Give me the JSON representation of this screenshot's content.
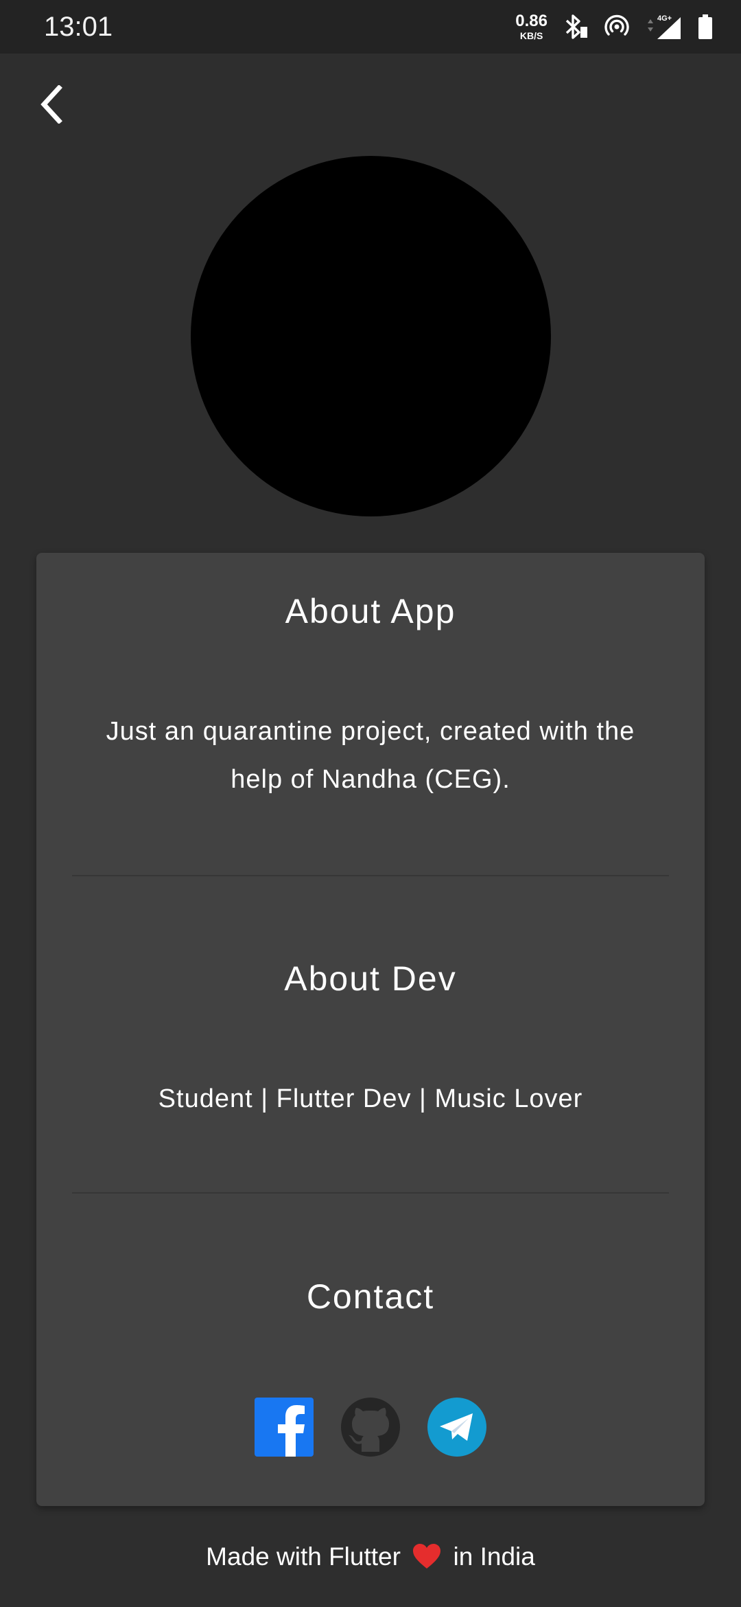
{
  "status_bar": {
    "time": "13:01",
    "net_speed_value": "0.86",
    "net_speed_unit": "KB/S",
    "network_type": "4G+",
    "icons": [
      "bluetooth-icon",
      "hotspot-icon",
      "signal-icon",
      "battery-icon"
    ]
  },
  "nav": {
    "back_icon": "chevron-left-icon"
  },
  "about_app": {
    "title": "About App",
    "text": "Just an quarantine project, created with the help of Nandha (CEG)."
  },
  "about_dev": {
    "title": "About Dev",
    "text": "Student | Flutter Dev | Music Lover"
  },
  "contact": {
    "title": "Contact",
    "links": [
      {
        "icon": "facebook-icon",
        "color": "#1877f2"
      },
      {
        "icon": "github-icon",
        "color": "#262626"
      },
      {
        "icon": "telegram-icon",
        "color": "#139bd0"
      }
    ]
  },
  "footer": {
    "text_before": "Made with Flutter",
    "text_after": "in India",
    "heart_color": "#e52d2d"
  },
  "colors": {
    "background": "#2e2e2e",
    "card": "#424242",
    "status_bar": "#232323",
    "avatar": "#000000"
  }
}
